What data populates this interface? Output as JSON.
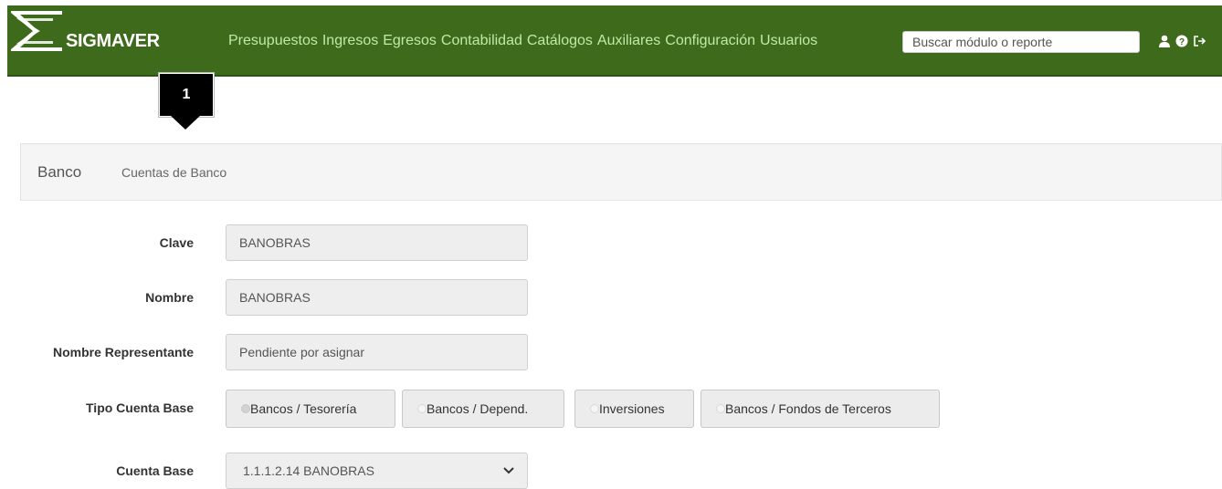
{
  "header": {
    "brand": "SIGMAVER",
    "menu": [
      "Presupuestos",
      "Ingresos",
      "Egresos",
      "Contabilidad",
      "Catálogos",
      "Auxiliares",
      "Configuración",
      "Usuarios"
    ],
    "search": {
      "placeholder": "Buscar módulo o reporte"
    },
    "icons": [
      "user-icon",
      "help-icon",
      "logout-icon"
    ]
  },
  "marker": {
    "number": "1"
  },
  "breadcrumb": {
    "section": "Banco",
    "page": "Cuentas de Banco"
  },
  "form": {
    "clave": {
      "label": "Clave",
      "value": "BANOBRAS"
    },
    "nombre": {
      "label": "Nombre",
      "value": "BANOBRAS"
    },
    "representante": {
      "label": "Nombre Representante",
      "value": "Pendiente por asignar"
    },
    "tipo": {
      "label": "Tipo Cuenta Base",
      "options": [
        "Bancos / Tesorería",
        "Bancos / Depend.",
        "Inversiones",
        "Bancos / Fondos de Terceros"
      ],
      "selected": "Bancos / Tesorería"
    },
    "cuenta": {
      "label": "Cuenta Base",
      "value": "1.1.1.2.14 BANOBRAS"
    }
  },
  "colors": {
    "navbar": "#3e6b1b",
    "nav_link": "#bfe9a8",
    "panel": "#f5f5f5"
  }
}
